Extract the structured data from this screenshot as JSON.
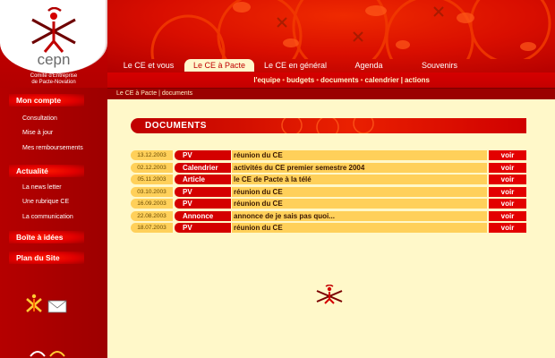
{
  "brand": {
    "logo_text": "cepn",
    "subtitle_line1": "Comité d'Entreprise",
    "subtitle_line2": "de Pacte-Novation"
  },
  "nav": {
    "items": [
      {
        "label": "Le CE et vous",
        "active": false
      },
      {
        "label": "Le CE à Pacte",
        "active": true
      },
      {
        "label": "Le CE en général",
        "active": false
      },
      {
        "label": "Agenda",
        "active": false
      },
      {
        "label": "Souvenirs",
        "active": false
      }
    ]
  },
  "subnav": {
    "items": [
      "l'equipe",
      "budgets",
      "documents",
      "calendrier",
      "actions"
    ]
  },
  "breadcrumb": "Le CE à Pacte | documents",
  "sidebar": {
    "mon_compte": {
      "title": "Mon compte",
      "links": [
        "Consultation",
        "Mise à jour",
        "Mes remboursements"
      ]
    },
    "actualite": {
      "title": "Actualité",
      "links": [
        "La news letter",
        "Une rubrique CE",
        "La communication"
      ]
    },
    "boite": {
      "title": "Boîte à idées"
    },
    "plan": {
      "title": "Plan du Site"
    }
  },
  "main": {
    "section_title": "DOCUMENTS",
    "documents": [
      {
        "date": "13.12.2003",
        "type": "PV",
        "title": "réunion du CE",
        "action": "voir"
      },
      {
        "date": "02.12.2003",
        "type": "Calendrier",
        "title": "activités du CE premier semestre 2004",
        "action": "voir"
      },
      {
        "date": "05.11.2003",
        "type": "Article",
        "title": "le CE de Pacte à la télé",
        "action": "voir"
      },
      {
        "date": "03.10.2003",
        "type": "PV",
        "title": "réunion du CE",
        "action": "voir"
      },
      {
        "date": "16.09.2003",
        "type": "PV",
        "title": "réunion du CE",
        "action": "voir"
      },
      {
        "date": "22.08.2003",
        "type": "Annonce",
        "title": "annonce de je sais pas quoi...",
        "action": "voir"
      },
      {
        "date": "18.07.2003",
        "type": "PV",
        "title": "réunion du CE",
        "action": "voir"
      }
    ]
  },
  "colors": {
    "brand_red": "#c00000",
    "cream": "#fff8c9",
    "gold": "#ffd05a"
  },
  "icons": [
    "cepn-figure-logo",
    "mail-envelope-icon",
    "small-figure-logo"
  ]
}
